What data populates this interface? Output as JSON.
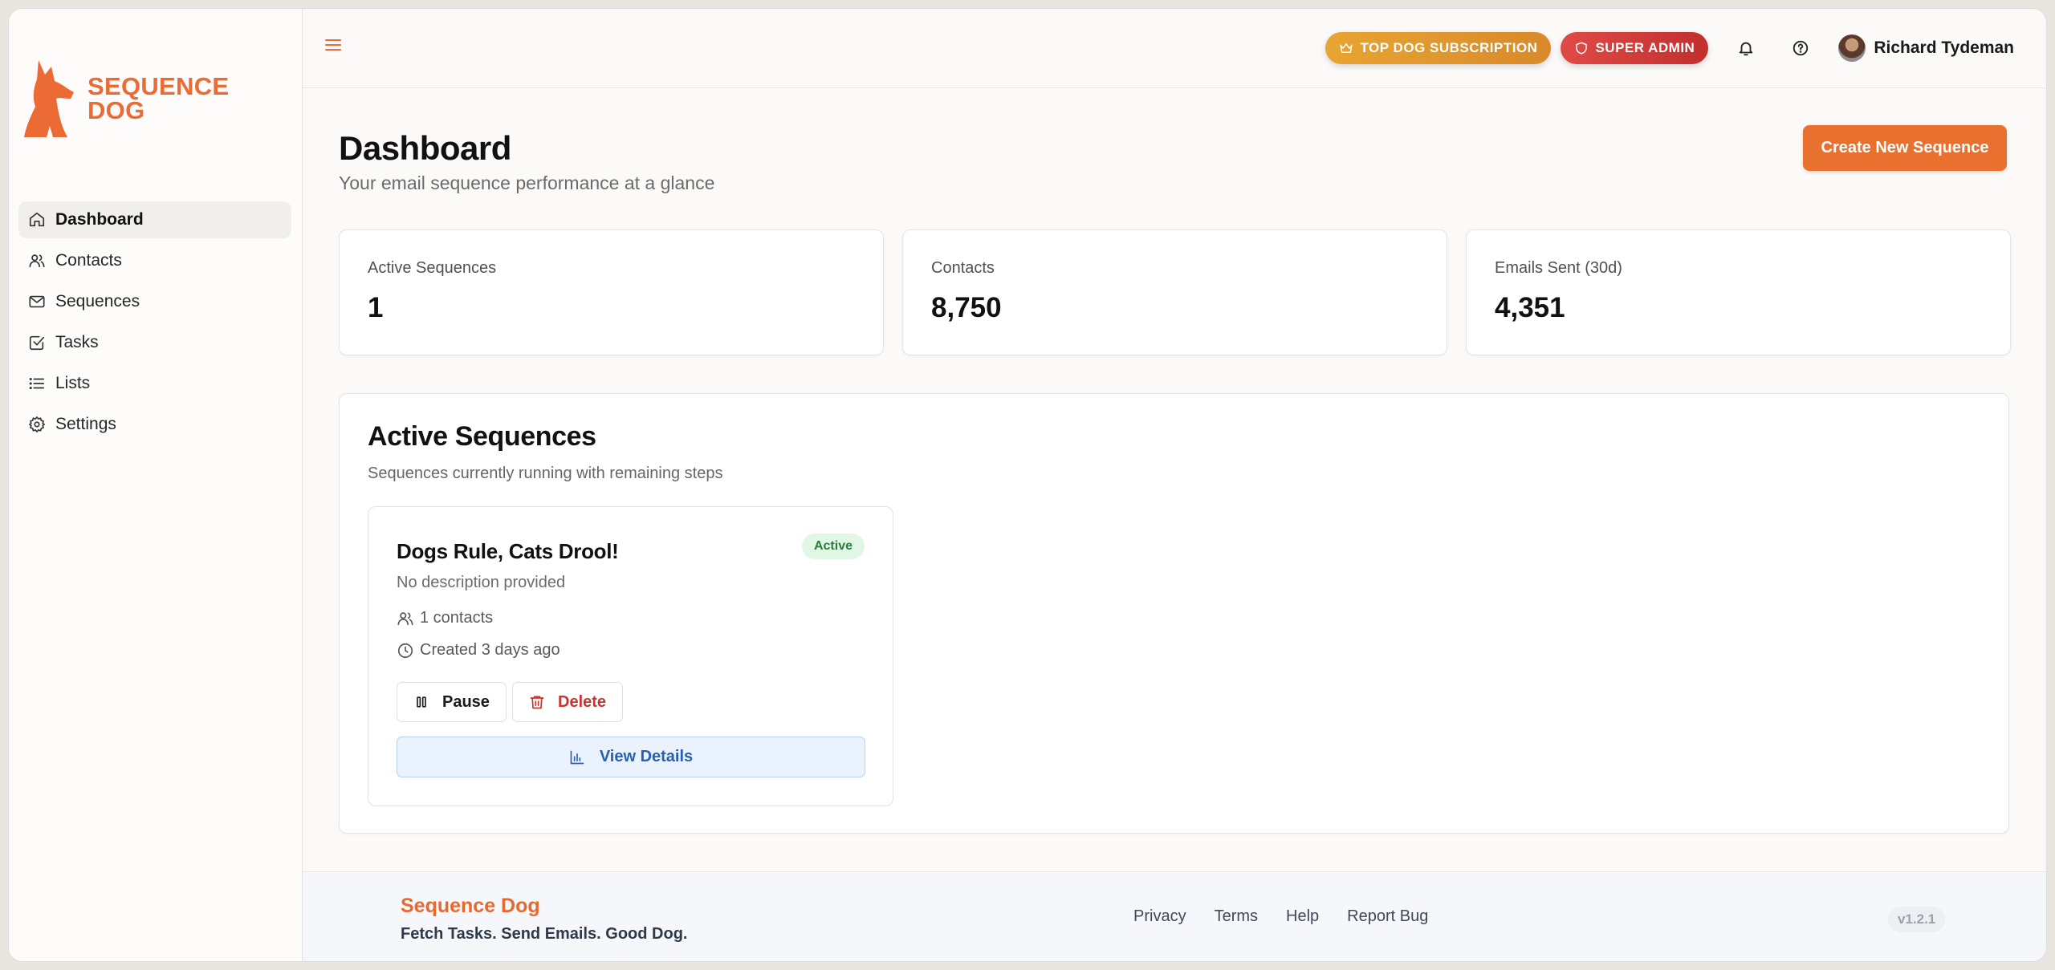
{
  "brand": {
    "logo_line1": "SEQUENCE",
    "logo_line2": "DOG",
    "accent": "#ec6a33"
  },
  "sidebar": {
    "items": [
      {
        "label": "Dashboard",
        "icon": "home-icon",
        "active": true
      },
      {
        "label": "Contacts",
        "icon": "users-icon"
      },
      {
        "label": "Sequences",
        "icon": "mail-icon"
      },
      {
        "label": "Tasks",
        "icon": "check-square-icon"
      },
      {
        "label": "Lists",
        "icon": "list-icon"
      },
      {
        "label": "Settings",
        "icon": "gear-icon"
      }
    ]
  },
  "topbar": {
    "subscription_label": "TOP DOG SUBSCRIPTION",
    "admin_label": "SUPER ADMIN",
    "user_name": "Richard Tydeman"
  },
  "page": {
    "title": "Dashboard",
    "subtitle": "Your email sequence performance at a glance",
    "create_label": "Create New Sequence"
  },
  "stats": [
    {
      "label": "Active Sequences",
      "value": "1"
    },
    {
      "label": "Contacts",
      "value": "8,750"
    },
    {
      "label": "Emails Sent (30d)",
      "value": "4,351"
    }
  ],
  "active_sequences": {
    "title": "Active Sequences",
    "subtitle": "Sequences currently running with remaining steps",
    "cards": [
      {
        "name": "Dogs Rule, Cats Drool!",
        "status": "Active",
        "description": "No description provided",
        "contacts": "1 contacts",
        "created": "Created 3 days ago",
        "pause_label": "Pause",
        "delete_label": "Delete",
        "details_label": "View Details"
      }
    ]
  },
  "footer": {
    "brand": "Sequence Dog",
    "tagline": "Fetch Tasks. Send Emails. Good Dog.",
    "links": [
      "Privacy",
      "Terms",
      "Help",
      "Report Bug"
    ],
    "version": "v1.2.1"
  }
}
